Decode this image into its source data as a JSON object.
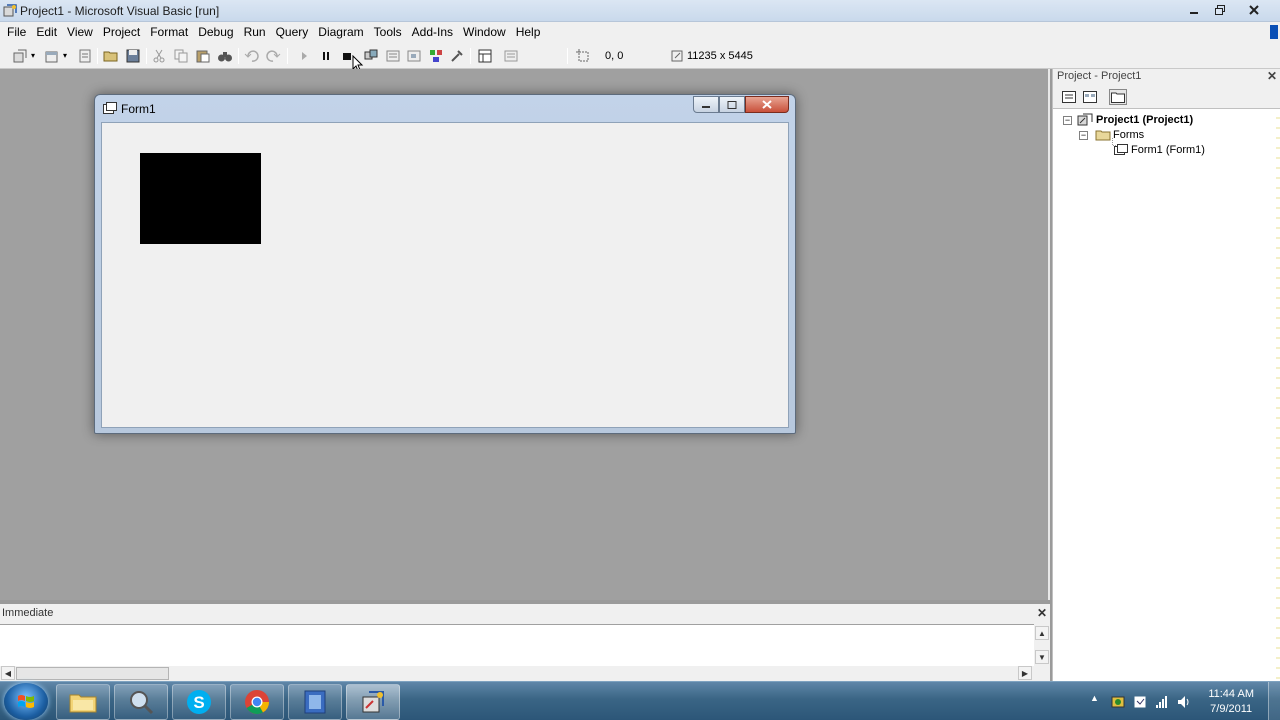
{
  "window": {
    "title": "Project1 - Microsoft Visual Basic [run]",
    "minimize_icon": "minimize-icon",
    "restore_icon": "restore-icon",
    "close_icon": "close-icon"
  },
  "menu": [
    "File",
    "Edit",
    "View",
    "Project",
    "Format",
    "Debug",
    "Run",
    "Query",
    "Diagram",
    "Tools",
    "Add-Ins",
    "Window",
    "Help"
  ],
  "toolbar": {
    "position_readout": "0, 0",
    "size_readout": "11235 x 5445"
  },
  "form": {
    "title": "Form1",
    "box_color": "#000000"
  },
  "project_explorer": {
    "title": "Project - Project1",
    "tree": {
      "project": "Project1 (Project1)",
      "folder": "Forms",
      "form": "Form1 (Form1)"
    }
  },
  "immediate": {
    "title": "Immediate"
  },
  "taskbar": {
    "apps": [
      "windows-explorer",
      "search",
      "skype",
      "chrome",
      "video-player",
      "visual-basic"
    ],
    "time": "11:44 AM",
    "date": "7/9/2011"
  },
  "colors": {
    "mdi_background": "#a0a0a0",
    "taskbar": "#3a6585",
    "chrome_bar": "#f0f0f0"
  }
}
